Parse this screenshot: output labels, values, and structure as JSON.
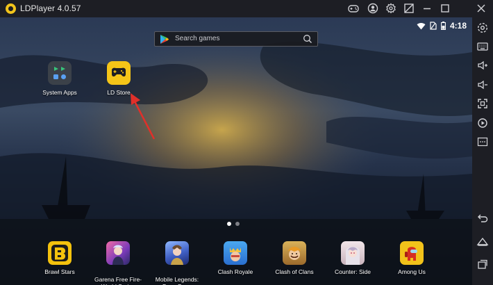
{
  "window": {
    "title": "LDPlayer 4.0.57"
  },
  "titlebar_icons": [
    "gamepad-icon",
    "account-icon",
    "settings-gear-icon",
    "screenshot-icon",
    "minimize-icon",
    "maximize-icon",
    "close-icon"
  ],
  "status_bar": {
    "time": "4:18",
    "icons": [
      "wifi-icon",
      "no-sim-icon",
      "battery-icon"
    ]
  },
  "search": {
    "placeholder": "Search games"
  },
  "desktop_apps": [
    {
      "label": "System Apps",
      "icon": "system-apps-icon"
    },
    {
      "label": "LD Store",
      "icon": "ld-store-icon"
    }
  ],
  "page_indicator": {
    "pages": 2,
    "current": 1
  },
  "dock_apps": [
    {
      "label": "Brawl Stars",
      "icon": "brawl-stars-icon",
      "color": "#f4c20d"
    },
    {
      "label": "Garena Free Fire-\nWorld Series",
      "icon": "free-fire-icon",
      "color": "#c84a8a"
    },
    {
      "label": "Mobile Legends:\nBang Bang",
      "icon": "mobile-legends-icon",
      "color": "#4a6fc8"
    },
    {
      "label": "Clash Royale",
      "icon": "clash-royale-icon",
      "color": "#3a8be0"
    },
    {
      "label": "Clash of Clans",
      "icon": "clash-of-clans-icon",
      "color": "#d8a040"
    },
    {
      "label": "Counter: Side",
      "icon": "counter-side-icon",
      "color": "#e8d8dc"
    },
    {
      "label": "Among Us",
      "icon": "among-us-icon",
      "color": "#f2c21a"
    }
  ],
  "sidebar_icons": [
    "settings-icon",
    "keyboard-icon",
    "volume-up-icon",
    "volume-down-icon",
    "fullscreen-icon",
    "record-icon",
    "more-icon",
    "back-icon",
    "home-icon",
    "recent-apps-icon"
  ],
  "colors": {
    "accent": "#f5c518",
    "chrome": "#1d1e24",
    "annotation_arrow": "#e0302a"
  }
}
